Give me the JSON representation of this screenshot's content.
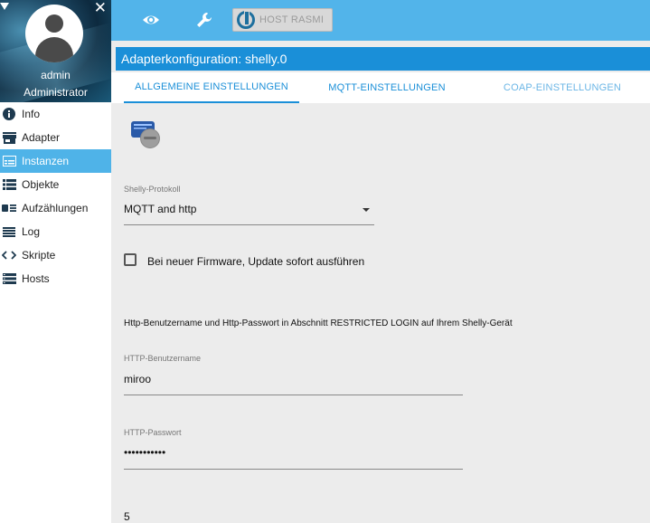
{
  "profile": {
    "user": "admin",
    "role": "Administrator"
  },
  "nav": {
    "items": [
      {
        "label": "Info",
        "icon": "info-icon"
      },
      {
        "label": "Adapter",
        "icon": "store-icon"
      },
      {
        "label": "Instanzen",
        "icon": "instances-icon",
        "active": true
      },
      {
        "label": "Objekte",
        "icon": "list-icon"
      },
      {
        "label": "Aufzählungen",
        "icon": "enum-icon"
      },
      {
        "label": "Log",
        "icon": "log-icon"
      },
      {
        "label": "Skripte",
        "icon": "code-icon"
      },
      {
        "label": "Hosts",
        "icon": "hosts-icon"
      }
    ]
  },
  "topbar": {
    "host_label": "HOST RASMI"
  },
  "title": "Adapterkonfiguration: shelly.0",
  "tabs": [
    "ALLGEMEINE EINSTELLUNGEN",
    "MQTT-EINSTELLUNGEN",
    "COAP-EINSTELLUNGEN"
  ],
  "form": {
    "protocol_label": "Shelly-Protokoll",
    "protocol_value": "MQTT and http",
    "update_checkbox_label": "Bei neuer Firmware, Update sofort ausführen",
    "update_checked": false,
    "info_text": "Http-Benutzername und Http-Passwort in Abschnitt RESTRICTED LOGIN auf Ihrem Shelly-Gerät",
    "http_user_label": "HTTP-Benutzername",
    "http_user_value": "miroo",
    "http_pass_label": "HTTP-Passwort",
    "http_pass_value": "•••••••••••",
    "partial_value": "5"
  },
  "colors": {
    "accent": "#1a8fd8",
    "topbar": "#52b4ea",
    "active_nav": "#4fb3e8",
    "background": "#ececec"
  }
}
